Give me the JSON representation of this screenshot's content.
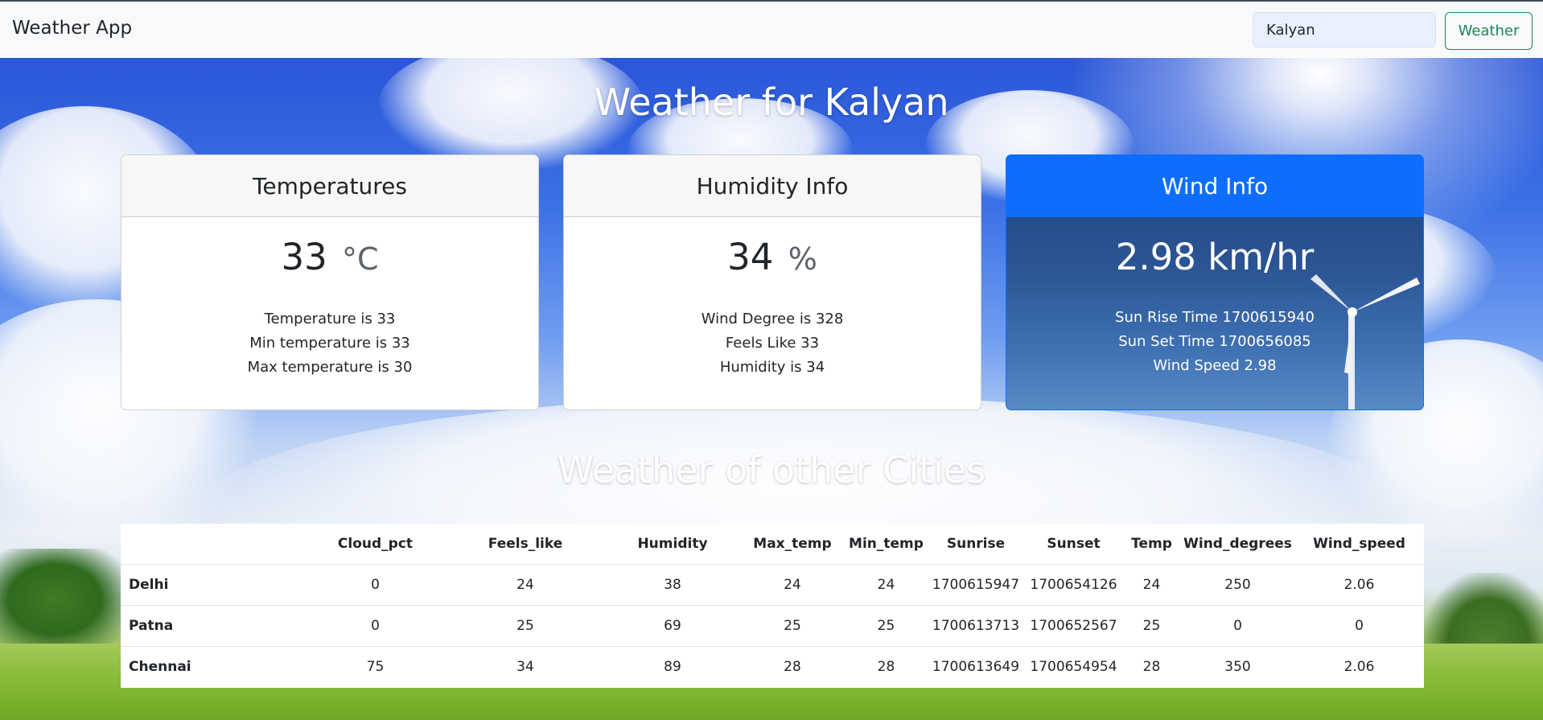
{
  "app": {
    "brand": "Weather App"
  },
  "search": {
    "value": "Kalyan",
    "button_label": "Weather"
  },
  "main": {
    "title": "Weather for Kalyan",
    "other_title": "Weather of other Cities"
  },
  "cards": {
    "temperatures": {
      "header": "Temperatures",
      "value": "33",
      "unit": "°C",
      "lines": [
        "Temperature is 33",
        "Min temperature is 33",
        "Max temperature is 30"
      ]
    },
    "humidity": {
      "header": "Humidity Info",
      "value": "34",
      "unit": "%",
      "lines": [
        "Wind Degree is 328",
        "Feels Like 33",
        "Humidity is 34"
      ]
    },
    "wind": {
      "header": "Wind Info",
      "value": "2.98 km/hr",
      "lines": [
        "Sun Rise Time 1700615940",
        "Sun Set Time 1700656085",
        "Wind Speed 2.98"
      ]
    }
  },
  "table": {
    "headers": [
      "",
      "Cloud_pct",
      "Feels_like",
      "Humidity",
      "Max_temp",
      "Min_temp",
      "Sunrise",
      "Sunset",
      "Temp",
      "Wind_degrees",
      "Wind_speed"
    ],
    "rows": [
      [
        "Delhi",
        "0",
        "24",
        "38",
        "24",
        "24",
        "1700615947",
        "1700654126",
        "24",
        "250",
        "2.06"
      ],
      [
        "Patna",
        "0",
        "25",
        "69",
        "25",
        "25",
        "1700613713",
        "1700652567",
        "25",
        "0",
        "0"
      ],
      [
        "Chennai",
        "75",
        "34",
        "89",
        "28",
        "28",
        "1700613649",
        "1700654954",
        "28",
        "350",
        "2.06"
      ]
    ]
  },
  "colors": {
    "primary": "#0d6efd",
    "success": "#198754",
    "navbar": "#f8f9fa"
  }
}
